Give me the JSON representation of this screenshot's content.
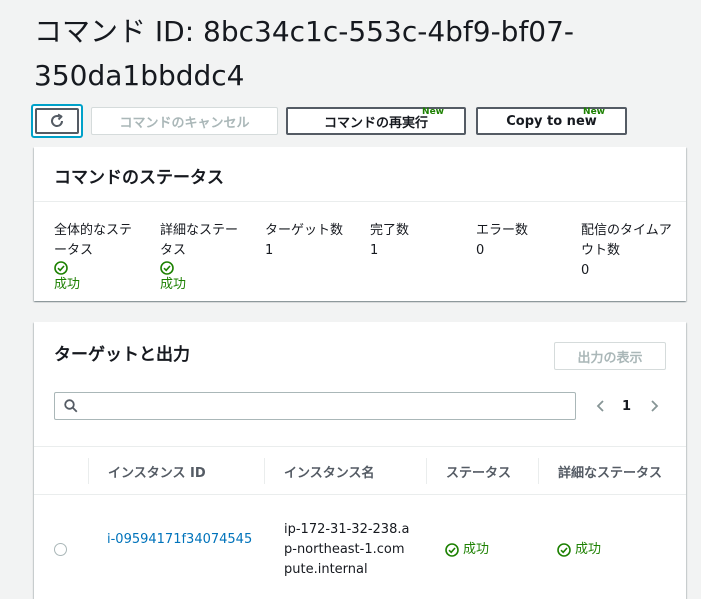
{
  "page": {
    "title": "コマンド ID: 8bc34c1c-553c-4bf9-bf07-350da1bbddc4"
  },
  "toolbar": {
    "cancel_label": "コマンドのキャンセル",
    "rerun_label": "コマンドの再実行",
    "rerun_badge": "New",
    "copy_label": "Copy to new",
    "copy_badge": "New"
  },
  "status_panel": {
    "header": "コマンドのステータス",
    "items": [
      {
        "label": "全体的なステータス",
        "value": "成功",
        "is_status": true
      },
      {
        "label": "詳細なステータス",
        "value": "成功",
        "is_status": true
      },
      {
        "label": "ターゲット数",
        "value": "1",
        "is_status": false
      },
      {
        "label": "完了数",
        "value": "1",
        "is_status": false
      },
      {
        "label": "エラー数",
        "value": "0",
        "is_status": false
      },
      {
        "label": "配信のタイムアウト数",
        "value": "0",
        "is_status": false
      }
    ]
  },
  "targets_panel": {
    "header": "ターゲットと出力",
    "show_output_label": "出力の表示",
    "search_placeholder": "",
    "page_number": "1",
    "columns": [
      "インスタンス ID",
      "インスタンス名",
      "ステータス",
      "詳細なステータス"
    ],
    "rows": [
      {
        "instance_id": "i-09594171f34074545",
        "instance_name": "ip-172-31-32-238.ap-northeast-1.compute.internal",
        "status": "成功",
        "detailed_status": "成功"
      }
    ]
  },
  "colors": {
    "success": "#1d8102",
    "link": "#0073bb",
    "focus": "#00a1c9"
  }
}
